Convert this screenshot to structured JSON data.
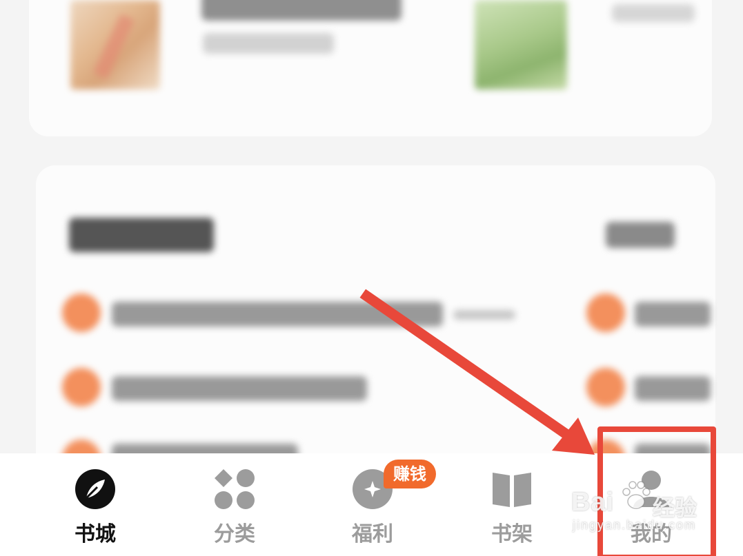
{
  "bottom_nav": {
    "tabs": [
      {
        "label": "书城",
        "icon": "bookstore-compass-icon",
        "active": true
      },
      {
        "label": "分类",
        "icon": "category-grid-icon",
        "active": false
      },
      {
        "label": "福利",
        "icon": "welfare-coin-icon",
        "active": false
      },
      {
        "label": "书架",
        "icon": "bookshelf-book-icon",
        "active": false
      },
      {
        "label": "我的",
        "icon": "profile-person-icon",
        "active": false
      }
    ],
    "welfare_badge": "赚钱"
  },
  "annotation": {
    "color": "#e8483a"
  },
  "watermark": {
    "brand": "Bai",
    "brand_cn": "经验",
    "site": "jingyan.baidu.com"
  },
  "colors": {
    "accent_orange": "#f16a2c",
    "active_tab": "#111111",
    "inactive_tab": "#9c9c9c"
  }
}
